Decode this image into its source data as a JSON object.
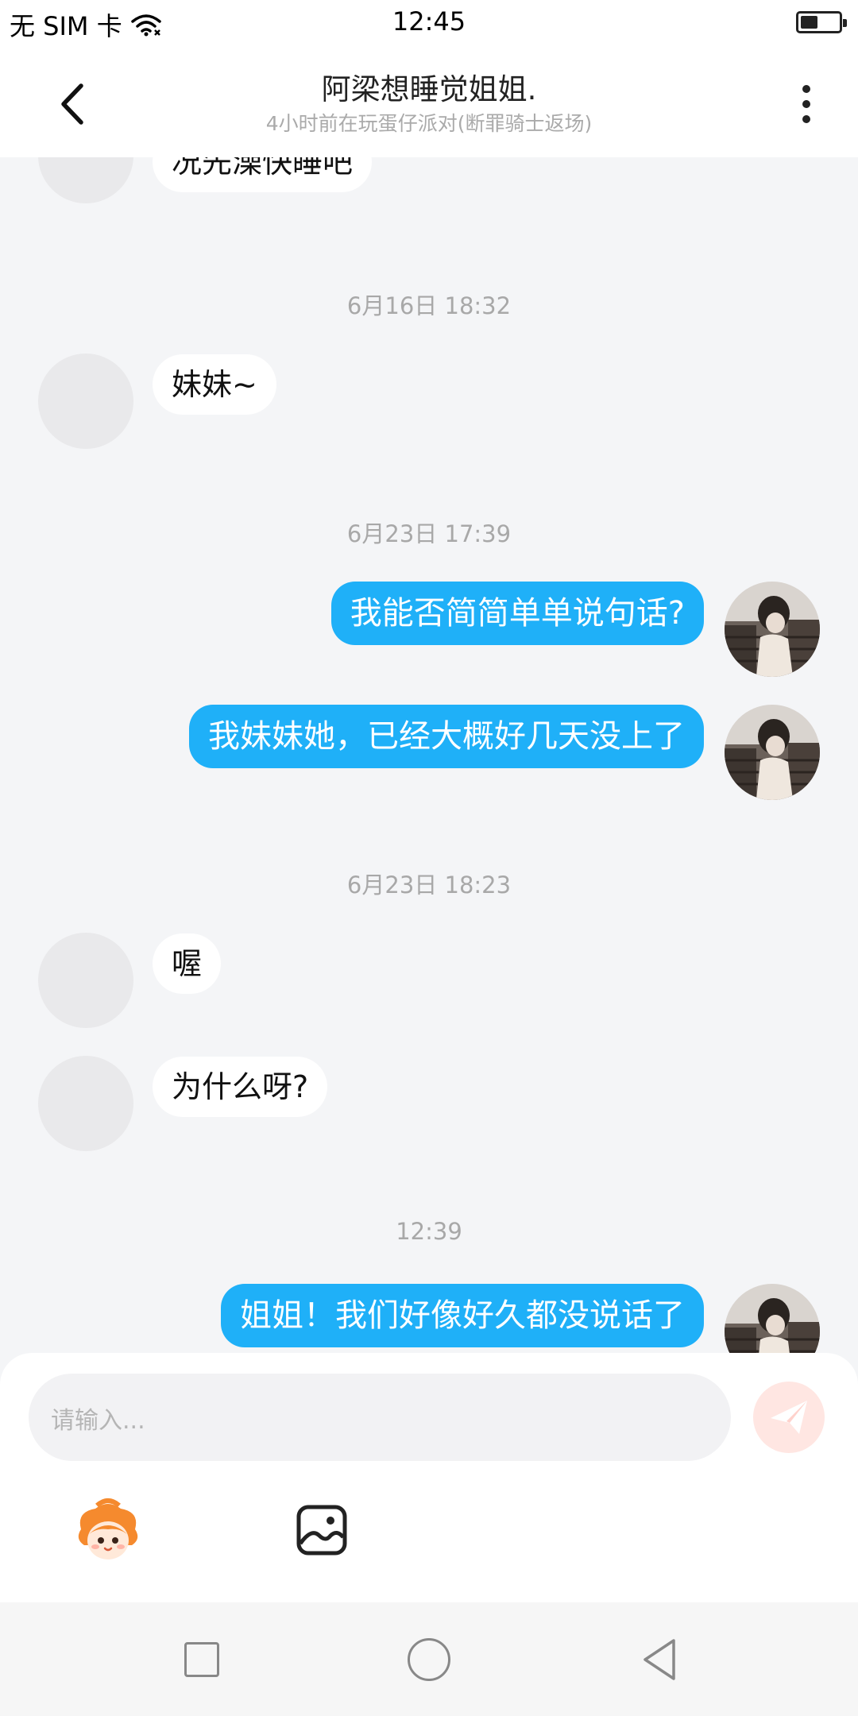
{
  "status_bar": {
    "carrier": "无 SIM 卡",
    "time": "12:45",
    "battery_level": 0.45
  },
  "header": {
    "title": "阿梁想睡觉姐姐.",
    "subtitle": "4小时前在玩蛋仔派对(断罪骑士返场)"
  },
  "messages": [
    {
      "type": "incoming",
      "text": "况先澡快睡吧"
    },
    {
      "type": "timestamp",
      "text": "6月16日 18:32"
    },
    {
      "type": "incoming",
      "text": "妹妹~"
    },
    {
      "type": "timestamp",
      "text": "6月23日 17:39"
    },
    {
      "type": "outgoing",
      "text": "我能否简简单单说句话?"
    },
    {
      "type": "outgoing",
      "text": "我妹妹她，已经大概好几天没上了"
    },
    {
      "type": "timestamp",
      "text": "6月23日 18:23"
    },
    {
      "type": "incoming",
      "text": "喔"
    },
    {
      "type": "incoming",
      "text": "为什么呀?"
    },
    {
      "type": "timestamp",
      "text": "12:39"
    },
    {
      "type": "outgoing",
      "text": "姐姐！我们好像好久都没说话了"
    }
  ],
  "input": {
    "placeholder": "请输入..."
  },
  "colors": {
    "outgoing_bubble": "#1fb0f8",
    "incoming_bubble": "#ffffff",
    "chat_background": "#f4f5f7",
    "send_button": "#ffe6e2"
  },
  "icons": {
    "back": "chevron-left-icon",
    "more": "more-vertical-icon",
    "wifi": "wifi-icon",
    "send": "paper-plane-icon",
    "emoji": "character-emoji-icon",
    "image": "image-icon"
  }
}
